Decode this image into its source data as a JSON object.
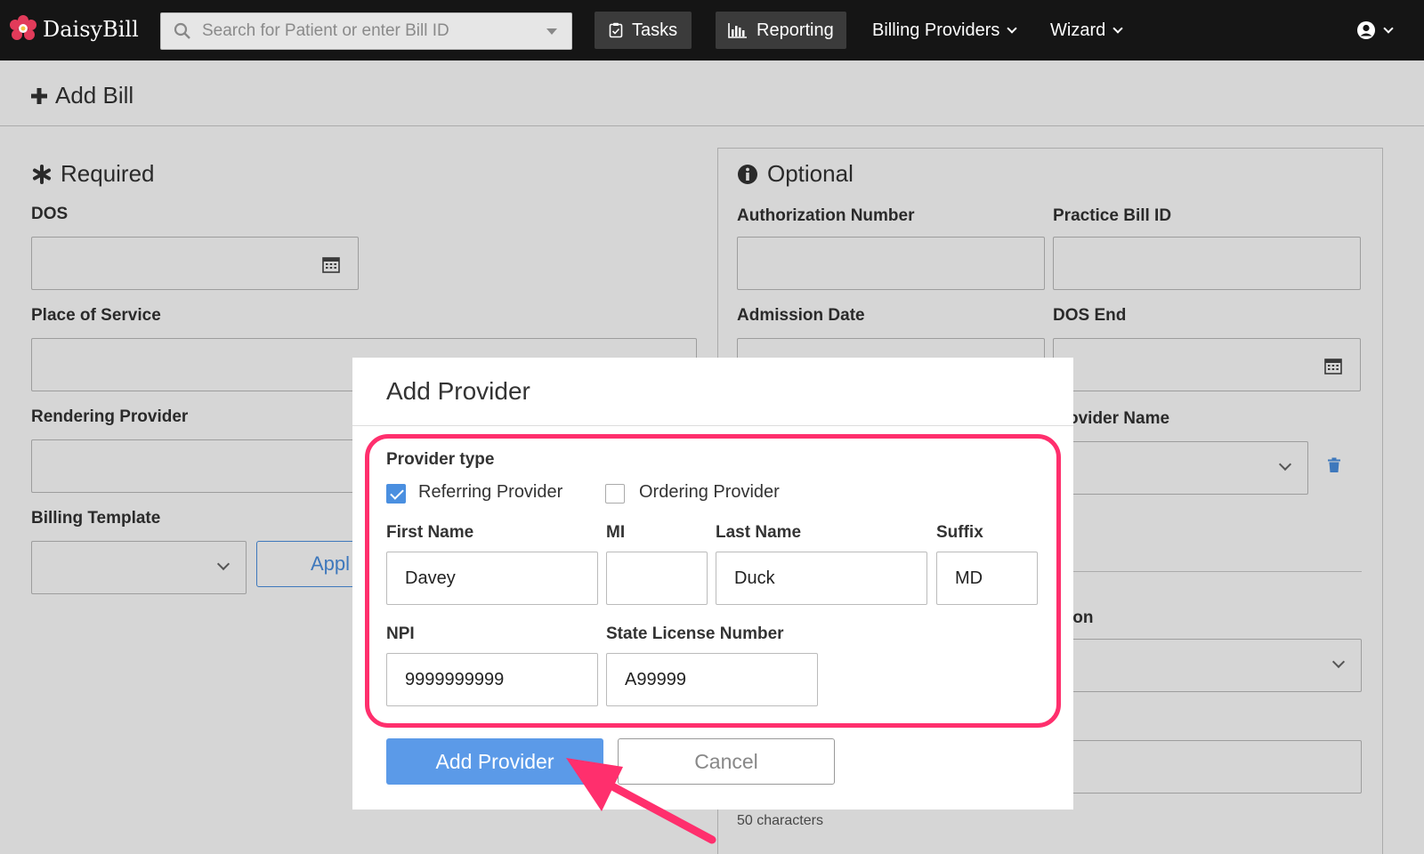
{
  "topbar": {
    "brand": "DaisyBill",
    "search_placeholder": "Search for Patient or enter Bill ID",
    "tasks_label": "Tasks",
    "reporting_label": "Reporting",
    "billing_providers_label": "Billing Providers",
    "wizard_label": "Wizard"
  },
  "page": {
    "title": "Add Bill",
    "required": {
      "title": "Required",
      "dos_label": "DOS",
      "place_of_service_label": "Place of Service",
      "rendering_provider_label": "Rendering Provider",
      "billing_template_label": "Billing Template",
      "apply_label": "Appl"
    },
    "optional": {
      "title": "Optional",
      "authorization_number_label": "Authorization Number",
      "practice_bill_id_label": "Practice Bill ID",
      "admission_date_label": "Admission Date",
      "dos_end_label": "DOS End",
      "provider_name_label_partial": "ovider Name",
      "partial_label_ion": "ion",
      "char_hint": "50 characters"
    }
  },
  "modal": {
    "title": "Add Provider",
    "provider_type_label": "Provider type",
    "referring_label": "Referring Provider",
    "referring_checked": true,
    "ordering_label": "Ordering Provider",
    "ordering_checked": false,
    "first_name_label": "First Name",
    "first_name_value": "Davey",
    "mi_label": "MI",
    "mi_value": "",
    "last_name_label": "Last Name",
    "last_name_value": "Duck",
    "suffix_label": "Suffix",
    "suffix_value": "MD",
    "npi_label": "NPI",
    "npi_value": "9999999999",
    "state_license_label": "State License Number",
    "state_license_value": "A99999",
    "add_button_label": "Add Provider",
    "cancel_button_label": "Cancel"
  },
  "colors": {
    "topbar": "#151515",
    "highlight": "#ff2f6d",
    "primary": "#5b9ae8",
    "checkbox": "#4a8fe0"
  }
}
